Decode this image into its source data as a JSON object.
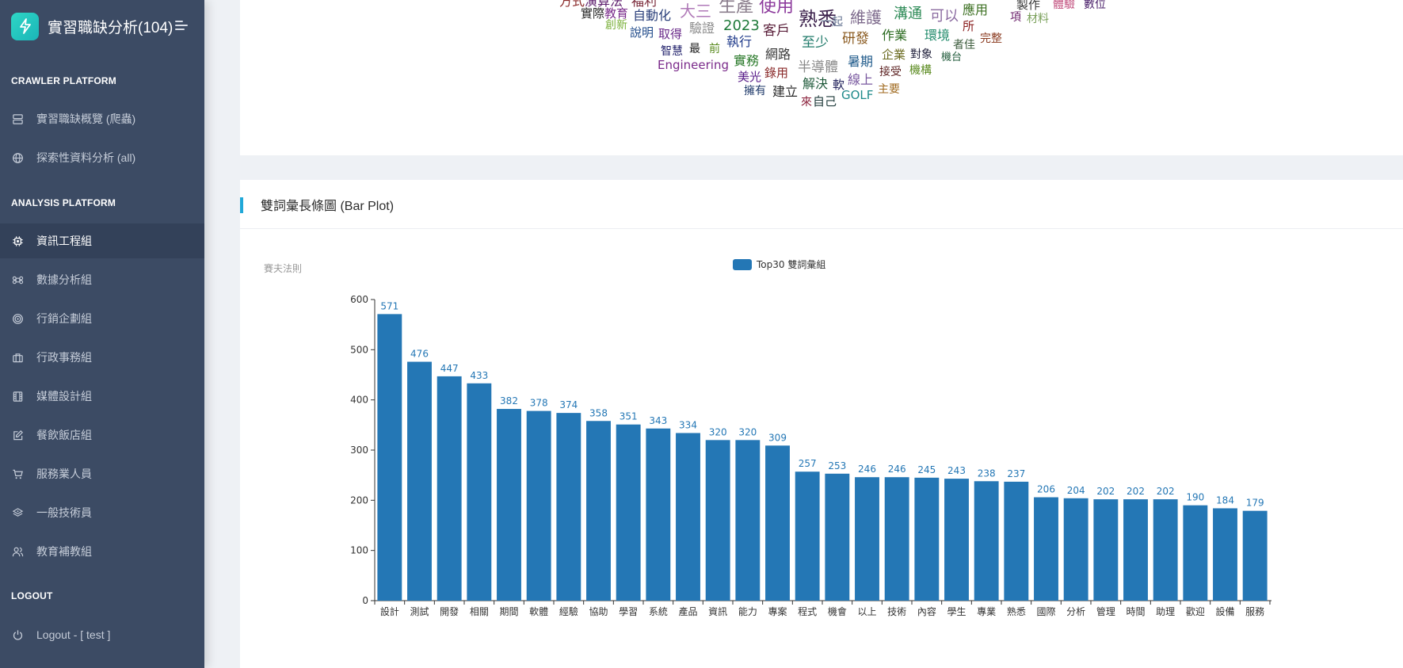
{
  "app": {
    "title": "實習職缺分析(104)"
  },
  "sidebar": {
    "sections": [
      {
        "title": "CRAWLER PLATFORM",
        "items": [
          {
            "label": "實習職缺概覽 (爬蟲)",
            "icon": "server-icon",
            "active": false
          },
          {
            "label": "探索性資料分析 (all)",
            "icon": "globe-icon",
            "active": false
          }
        ]
      },
      {
        "title": "ANALYSIS PLATFORM",
        "items": [
          {
            "label": "資訊工程組",
            "icon": "chip-icon",
            "active": true
          },
          {
            "label": "數據分析組",
            "icon": "command-icon",
            "active": false
          },
          {
            "label": "行銷企劃組",
            "icon": "target-icon",
            "active": false
          },
          {
            "label": "行政事務組",
            "icon": "briefcase-icon",
            "active": false
          },
          {
            "label": "媒體設計組",
            "icon": "film-icon",
            "active": false
          },
          {
            "label": "餐飲飯店組",
            "icon": "edit-icon",
            "active": false
          },
          {
            "label": "服務業人員",
            "icon": "cart-icon",
            "active": false
          },
          {
            "label": "一般技術員",
            "icon": "layers-icon",
            "active": false
          },
          {
            "label": "教育補教組",
            "icon": "people-icon",
            "active": false
          }
        ]
      },
      {
        "title": "LOGOUT",
        "items": [
          {
            "label": "Logout - [ test ]",
            "icon": "power-icon",
            "active": false
          }
        ]
      }
    ]
  },
  "wordcloud": {
    "words": [
      {
        "t": "方式",
        "c": "#8b2b2b"
      },
      {
        "t": "演算法",
        "c": "#5e1f6e"
      },
      {
        "t": "福利",
        "c": "#7a2a3a"
      },
      {
        "t": "實際",
        "c": "#222222"
      },
      {
        "t": "教育",
        "c": "#7b2d8c"
      },
      {
        "t": "自動化",
        "c": "#2a3f7a"
      },
      {
        "t": "大三",
        "c": "#b07ab8"
      },
      {
        "t": "生產",
        "c": "#8a7d8c"
      },
      {
        "t": "使用",
        "c": "#8c3a9c"
      },
      {
        "t": "熟悉",
        "c": "#3a1f4a"
      },
      {
        "t": "維護",
        "c": "#7d6a8c"
      },
      {
        "t": "溝通",
        "c": "#2e8b57"
      },
      {
        "t": "可以",
        "c": "#8a6aa0"
      },
      {
        "t": "應用",
        "c": "#3a6e1f"
      },
      {
        "t": "製作",
        "c": "#3a3a3a"
      },
      {
        "t": "體驗",
        "c": "#c04a7a"
      },
      {
        "t": "數位",
        "c": "#4a1f6a"
      },
      {
        "t": "創新",
        "c": "#7ab03a"
      },
      {
        "t": "說明",
        "c": "#1f4a8a"
      },
      {
        "t": "取得",
        "c": "#6a2a8a"
      },
      {
        "t": "驗證",
        "c": "#8a8a8a"
      },
      {
        "t": "2023",
        "c": "#1f7a3a"
      },
      {
        "t": "客戶",
        "c": "#5a1f3a"
      },
      {
        "t": "一起",
        "c": "#5a6a8a"
      },
      {
        "t": "所",
        "c": "#8a1f1f"
      },
      {
        "t": "項",
        "c": "#6a1f6a"
      },
      {
        "t": "材料",
        "c": "#7aa05a"
      },
      {
        "t": "智慧",
        "c": "#1f1f6a"
      },
      {
        "t": "最",
        "c": "#222222"
      },
      {
        "t": "前",
        "c": "#5a8a1f"
      },
      {
        "t": "執行",
        "c": "#1f3a8a"
      },
      {
        "t": "至少",
        "c": "#1f7a6a"
      },
      {
        "t": "研發",
        "c": "#8a5a1f"
      },
      {
        "t": "作業",
        "c": "#2a6a1f"
      },
      {
        "t": "環境",
        "c": "#1f8a6a"
      },
      {
        "t": "者佳",
        "c": "#3a5a3a"
      },
      {
        "t": "完整",
        "c": "#8a3a1f"
      },
      {
        "t": "Engineering",
        "c": "#7a2a8a"
      },
      {
        "t": "實務",
        "c": "#2a7a2a"
      },
      {
        "t": "網路",
        "c": "#3a3a3a"
      },
      {
        "t": "半導體",
        "c": "#8a8a8a"
      },
      {
        "t": "暑期",
        "c": "#1f5a8a"
      },
      {
        "t": "企業",
        "c": "#6a6a1f"
      },
      {
        "t": "對象",
        "c": "#1f1f3a"
      },
      {
        "t": "機台",
        "c": "#1f5a3a"
      },
      {
        "t": "美光",
        "c": "#5a1f8a"
      },
      {
        "t": "錄用",
        "c": "#8a2a2a"
      },
      {
        "t": "線上",
        "c": "#7a5aa0"
      },
      {
        "t": "接受",
        "c": "#5a1f1f"
      },
      {
        "t": "機構",
        "c": "#5a8a1f"
      },
      {
        "t": "擁有",
        "c": "#1f3a6a"
      },
      {
        "t": "建立",
        "c": "#2a2a2a"
      },
      {
        "t": "解決",
        "c": "#1f5a3a"
      },
      {
        "t": "軟",
        "c": "#1f1f5a"
      },
      {
        "t": "GOLF",
        "c": "#1f8a8a"
      },
      {
        "t": "主要",
        "c": "#a06a1f"
      },
      {
        "t": "來",
        "c": "#8a1f3a"
      },
      {
        "t": "自己",
        "c": "#1f3a3a"
      }
    ]
  },
  "bar_card": {
    "title": "雙詞彙長條圖 (Bar Plot)"
  },
  "chart_data": {
    "type": "bar",
    "title": "",
    "subtitle": "賽夫法則",
    "legend": "Top30 雙詞彙組",
    "legend_position": "top-center",
    "color": "#2477b5",
    "ylim": [
      0,
      600
    ],
    "yticks": [
      0,
      100,
      200,
      300,
      400,
      500,
      600
    ],
    "categories": [
      "設計",
      "測試",
      "開發",
      "相關",
      "期間",
      "軟體",
      "經驗",
      "協助",
      "學習",
      "系統",
      "產品",
      "資訊",
      "能力",
      "專案",
      "程式",
      "機會",
      "以上",
      "技術",
      "內容",
      "學生",
      "專業",
      "熟悉",
      "國際",
      "分析",
      "管理",
      "時間",
      "助理",
      "歡迎",
      "設備",
      "服務"
    ],
    "values": [
      571,
      476,
      447,
      433,
      382,
      378,
      374,
      358,
      351,
      343,
      334,
      320,
      320,
      309,
      257,
      253,
      246,
      246,
      245,
      243,
      238,
      237,
      206,
      204,
      202,
      202,
      202,
      190,
      184,
      179
    ]
  }
}
